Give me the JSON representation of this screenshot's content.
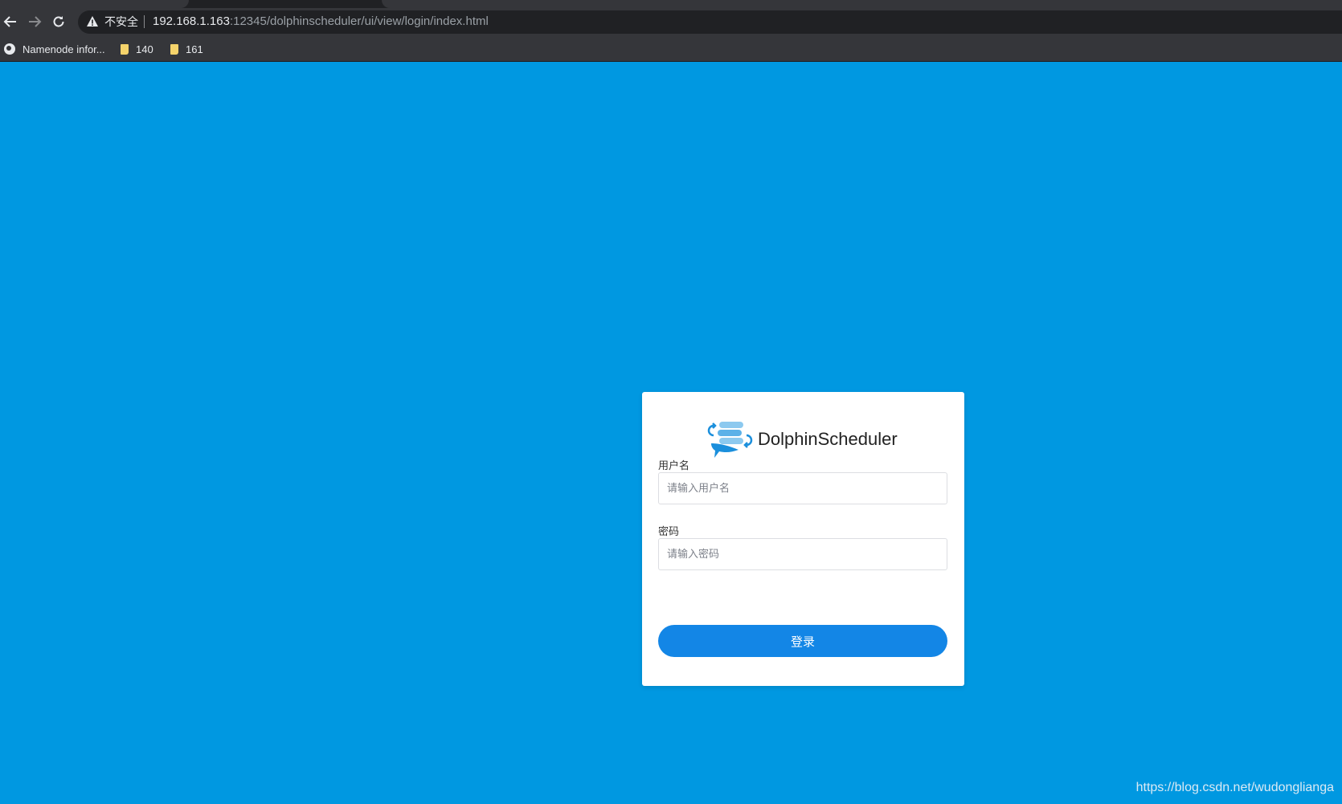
{
  "browser": {
    "security_label": "不安全",
    "url_host": "192.168.1.163",
    "url_rest": ":12345/dolphinscheduler/ui/view/login/index.html",
    "bookmarks": [
      {
        "label": "Namenode infor...",
        "icon": "globe-icon"
      },
      {
        "label": "140",
        "icon": "folder-icon"
      },
      {
        "label": "161",
        "icon": "folder-icon"
      }
    ]
  },
  "login": {
    "brand": "DolphinScheduler",
    "username_label": "用户名",
    "username_placeholder": "请输入用户名",
    "password_label": "密码",
    "password_placeholder": "请输入密码",
    "submit_label": "登录"
  },
  "watermark": "https://blog.csdn.net/wudonglianga",
  "colors": {
    "page_background": "#0098e1",
    "button": "#1386e6",
    "chrome": "#35363a"
  }
}
